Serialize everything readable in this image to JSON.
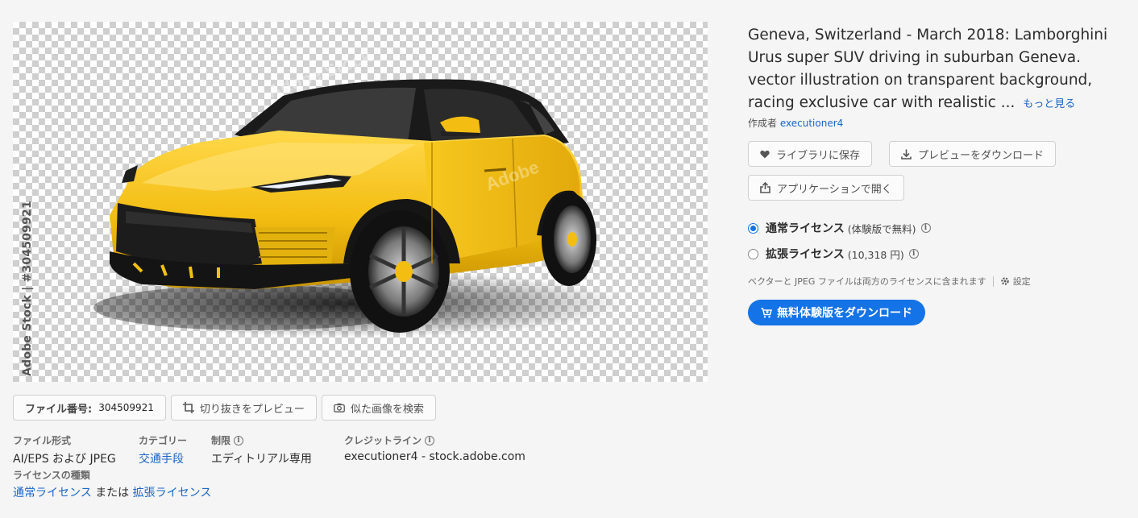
{
  "preview": {
    "watermark_vertical": "Adobe Stock | #304509921"
  },
  "image_actions": {
    "file_number_label": "ファイル番号:",
    "file_number_value": "304509921",
    "crop_preview_label": "切り抜きをプレビュー",
    "find_similar_label": "似た画像を検索"
  },
  "details": {
    "file_type_label": "ファイル形式",
    "file_type_value": "AI/EPS および JPEG",
    "license_type_label": "ライセンスの種類",
    "standard_license_link": "通常ライセンス",
    "or_text": "または",
    "extended_license_link": "拡張ライセンス",
    "category_label": "カテゴリー",
    "category_value": "交通手段",
    "restriction_label": "制限",
    "restriction_value": "エディトリアル専用",
    "credit_label": "クレジットライン",
    "credit_value": "executioner4 - stock.adobe.com"
  },
  "asset": {
    "title": "Geneva, Switzerland - March 2018: Lamborghini Urus super SUV driving in suburban Geneva. vector illustration on transparent background, racing exclusive car with realistic ...",
    "more_link": "もっと見る",
    "author_prefix": "作成者",
    "author_name": "executioner4"
  },
  "buttons": {
    "save_library": "ライブラリに保存",
    "download_preview": "プレビューをダウンロード",
    "open_in_app": "アプリケーションで開く"
  },
  "licenses": {
    "standard_name": "通常ライセンス",
    "standard_sub": "(体験版で無料)",
    "extended_name": "拡張ライセンス",
    "extended_sub": "(10,318 円)",
    "selected": "standard",
    "note": "ベクターと JPEG ファイルは両方のライセンスに含まれます",
    "settings_label": "設定"
  },
  "primary_button": {
    "label": "無料体験版をダウンロード"
  },
  "colors": {
    "accent": "#1473e6",
    "link": "#1a66c9",
    "car_body": "#f5c316",
    "background": "#f5f5f5"
  },
  "icons": {
    "heart": "heart-icon",
    "download": "download-icon",
    "share": "share-icon",
    "crop": "crop-icon",
    "camera": "camera-icon",
    "info": "info-icon",
    "gear": "gear-icon",
    "cart": "cart-icon"
  }
}
